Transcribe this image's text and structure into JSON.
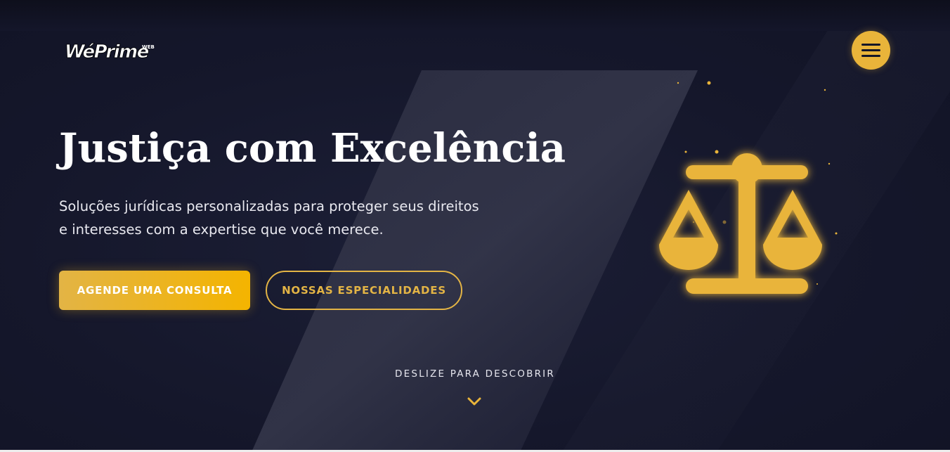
{
  "brand": {
    "logo_text": "WéPrime",
    "logo_suffix": "WEB"
  },
  "header": {
    "menu_icon": "hamburger-icon"
  },
  "hero": {
    "title": "Justiça com Excelência",
    "subtitle": "Soluções jurídicas personalizadas para proteger seus direitos e interesses com a expertise que você merece.",
    "primary_cta": "AGENDE UMA CONSULTA",
    "secondary_cta": "NOSSAS ESPECIALIDADES",
    "scroll_hint": "DESLIZE PARA DESCOBRIR",
    "illustration_icon": "scales-of-justice-icon",
    "scroll_icon": "chevron-down-icon"
  },
  "colors": {
    "accent": "#e9b43a",
    "background": "#14162a",
    "text": "#ffffff"
  }
}
